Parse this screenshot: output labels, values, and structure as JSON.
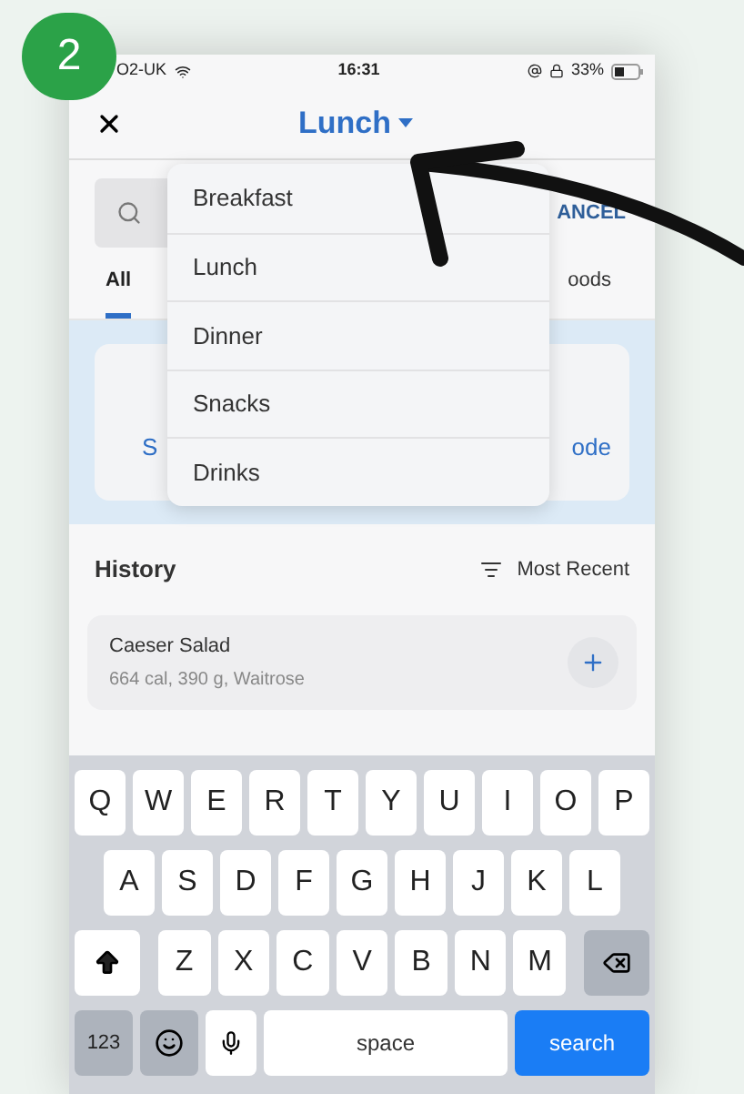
{
  "step_badge": "2",
  "status_bar": {
    "carrier": "O2-UK",
    "time": "16:31",
    "battery": "33%"
  },
  "header": {
    "title": "Lunch"
  },
  "search": {
    "action": "ANCEL"
  },
  "tabs": [
    {
      "label": "All",
      "selected": true
    },
    {
      "label": "oods",
      "selected": false
    }
  ],
  "card": {
    "left_link": "S",
    "right_link": "ode"
  },
  "meal_menu": {
    "items": [
      {
        "label": "Breakfast"
      },
      {
        "label": "Lunch"
      },
      {
        "label": "Dinner"
      },
      {
        "label": "Snacks"
      },
      {
        "label": "Drinks"
      }
    ]
  },
  "history": {
    "title": "History",
    "sort": "Most Recent",
    "items": [
      {
        "name": "Caeser Salad",
        "details": "664 cal, 390 g, Waitrose"
      }
    ]
  },
  "keyboard": {
    "rows": [
      [
        "Q",
        "W",
        "E",
        "R",
        "T",
        "Y",
        "U",
        "I",
        "O",
        "P"
      ],
      [
        "A",
        "S",
        "D",
        "F",
        "G",
        "H",
        "J",
        "K",
        "L"
      ],
      [
        "Z",
        "X",
        "C",
        "V",
        "B",
        "N",
        "M"
      ]
    ],
    "number_key": "123",
    "space": "space",
    "action": "search"
  }
}
